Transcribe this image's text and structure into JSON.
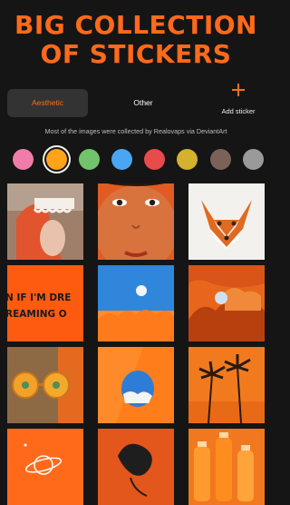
{
  "headline": {
    "line1": "BIG COLLECTION",
    "line2": "OF STICKERS"
  },
  "tabs": {
    "active_label": "Aesthetic",
    "other_label": "Other"
  },
  "add_sticker": {
    "label": "Add sticker",
    "icon": "plus-icon"
  },
  "caption": "Most of the images were collected by Realovaps via DeviantArt",
  "colors": {
    "accent": "#ff6a1a",
    "swatches": [
      "#f07cab",
      "#ffa31a",
      "#71c46b",
      "#4aa6f2",
      "#e84b4b",
      "#d4b12e",
      "#7a6258",
      "#9a9a9a"
    ],
    "selected_index": 1
  },
  "tiles": {
    "text_line1": "N IF I'M DRE",
    "text_line2": "REAMING O"
  }
}
